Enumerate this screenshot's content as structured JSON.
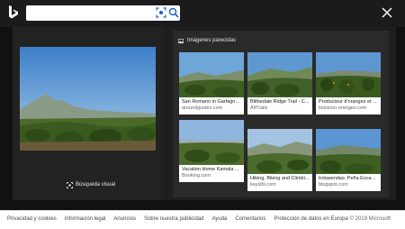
{
  "search": {
    "value": "",
    "placeholder": ""
  },
  "left_pane": {
    "visual_search_label": "Búsqueda visual"
  },
  "similar_images": {
    "header": "Imágenes parecidas",
    "cards": [
      {
        "title": "San Romano in Garfagna...",
        "source": "aroundguides.com"
      },
      {
        "title": "Blithedale Ridge Trail - C...",
        "source": "AllTrails"
      },
      {
        "title": "Producteur d'oranges et ...",
        "source": "bvisison-oranges.com"
      },
      {
        "title": "Vacation Home Kamala ...",
        "source": "Booking.com"
      },
      {
        "title": "Hiking, Biking and Climbi...",
        "source": "keyslbi.com"
      },
      {
        "title": "trotasendas: Peña Escab...",
        "source": "blogspot.com"
      }
    ]
  },
  "footer": {
    "links": [
      "Privacidad y cookies",
      "Información legal",
      "Anuncios",
      "Sobre nuestra publicidad",
      "Ayuda",
      "Comentarios",
      "Protección de datos en Europa"
    ],
    "copyright": "© 2019 Microsoft"
  }
}
